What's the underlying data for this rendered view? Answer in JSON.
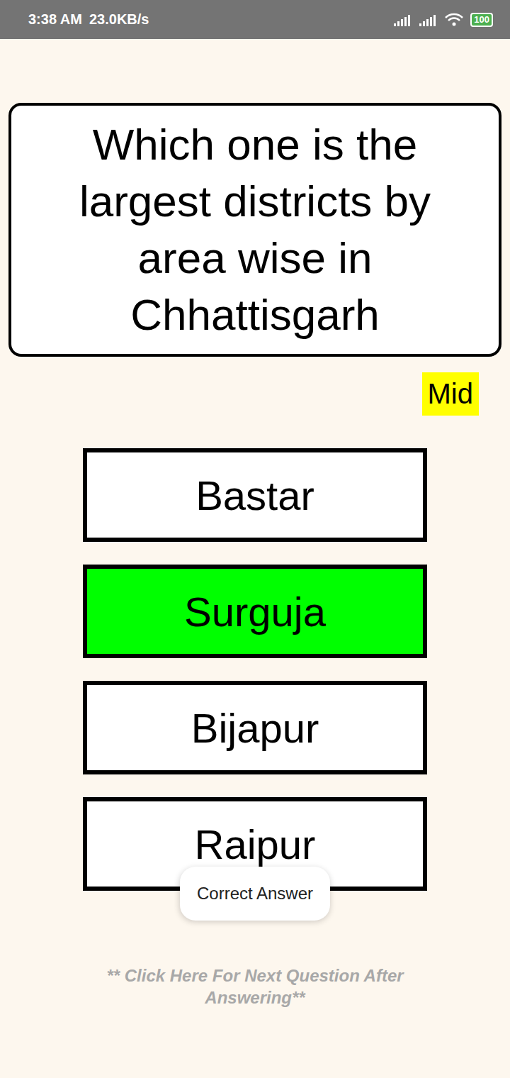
{
  "status_bar": {
    "time": "3:38 AM",
    "speed": "23.0KB/s",
    "battery": "100"
  },
  "question": {
    "text": "Which one is the largest districts by area wise in Chhattisgarh",
    "difficulty": "Mid"
  },
  "options": [
    {
      "label": "Bastar",
      "selected": false
    },
    {
      "label": "Surguja",
      "selected": true
    },
    {
      "label": "Bijapur",
      "selected": false
    },
    {
      "label": "Raipur",
      "selected": false
    }
  ],
  "toast": "Correct Answer",
  "footer": "** Click Here For Next Question After Answering**"
}
